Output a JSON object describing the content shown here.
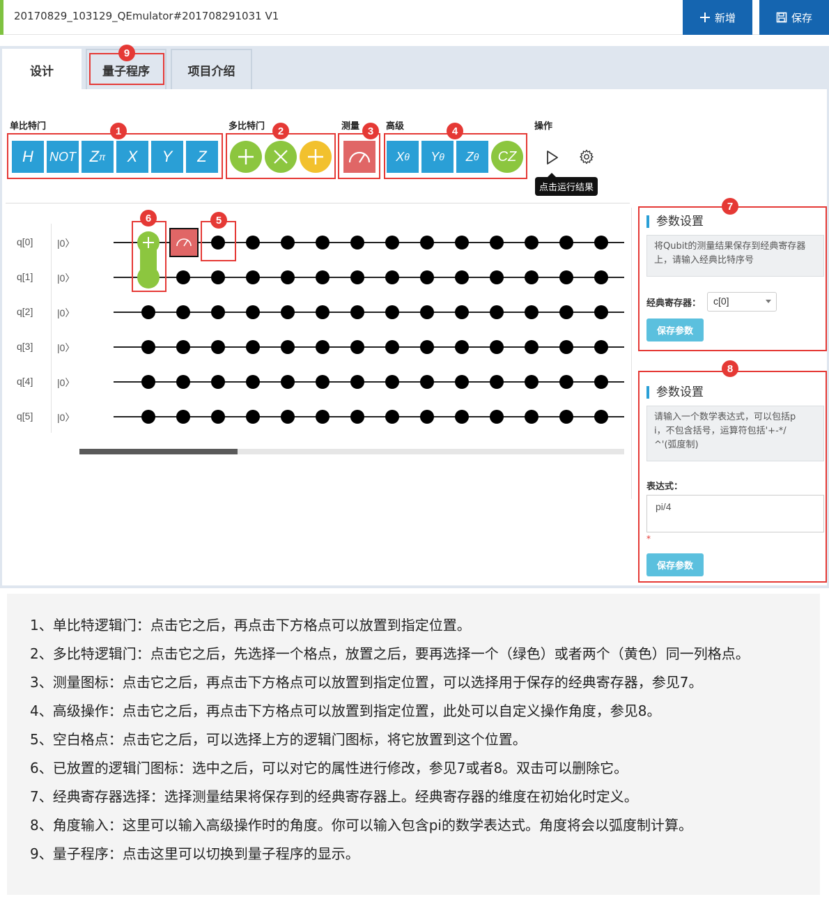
{
  "header": {
    "title": "20170829_103129_QEmulator#201708291031 V1",
    "add_label": "新增",
    "save_label": "保存"
  },
  "tabs": [
    {
      "label": "设计"
    },
    {
      "label": "量子程序"
    },
    {
      "label": "项目介绍"
    }
  ],
  "toolbar": {
    "groups": [
      "单比特门",
      "多比特门",
      "测量",
      "高级",
      "操作"
    ],
    "single_gates": [
      "H",
      "NOT",
      "X",
      "Y",
      "Z"
    ],
    "zpi": {
      "base": "Z",
      "sub": "π"
    },
    "advanced_gates": [
      {
        "base": "X",
        "sub": "θ"
      },
      {
        "base": "Y",
        "sub": "θ"
      },
      {
        "base": "Z",
        "sub": "θ"
      }
    ],
    "cz_label": "CZ",
    "run_tooltip": "点击运行结果",
    "icons": [
      "plus-icon",
      "cross-icon",
      "measure-icon",
      "play-icon",
      "gear-icon"
    ]
  },
  "circuit": {
    "qubits": [
      "q[0]",
      "q[1]",
      "q[2]",
      "q[3]",
      "q[4]",
      "q[5]"
    ],
    "init_states": [
      "|0〉",
      "|0〉",
      "|0〉",
      "|0〉",
      "|0〉",
      "|0〉"
    ],
    "scrollbar_fraction": 0.29
  },
  "param_panel_1": {
    "title": "参数设置",
    "desc_line1": "将Qubit的测量结果保存到经典寄存器",
    "desc_line2": "上，请输入经典比特序号",
    "register_label": "经典寄存器：",
    "register_value": "c[0]",
    "save_label": "保存参数"
  },
  "param_panel_2": {
    "title": "参数设置",
    "desc_line1": "请输入一个数学表达式，可以包括p",
    "desc_line2": "i，不包含括号，运算符包括'+-*/",
    "desc_line3": "^'(弧度制)",
    "expr_label": "表达式：",
    "expr_value": "pi/4",
    "required_mark": "*",
    "save_label": "保存参数"
  },
  "badges": [
    "1",
    "2",
    "3",
    "4",
    "5",
    "6",
    "7",
    "8",
    "9"
  ],
  "notes": [
    "1、单比特逻辑门：点击它之后，再点击下方格点可以放置到指定位置。",
    "2、多比特逻辑门：点击它之后，先选择一个格点，放置之后，要再选择一个（绿色）或者两个（黄色）同一列格点。",
    "3、测量图标：点击它之后，再点击下方格点可以放置到指定位置，可以选择用于保存的经典寄存器，参见7。",
    "4、高级操作：点击它之后，再点击下方格点可以放置到指定位置，此处可以自定义操作角度，参见8。",
    "5、空白格点：点击它之后，可以选择上方的逻辑门图标，将它放置到这个位置。",
    "6、已放置的逻辑门图标：选中之后，可以对它的属性进行修改，参见7或者8。双击可以删除它。",
    "7、经典寄存器选择：选择测量结果将保存到的经典寄存器上。经典寄存器的维度在初始化时定义。",
    "8、角度输入：这里可以输入高级操作时的角度。你可以输入包含pi的数学表达式。角度将会以弧度制计算。",
    "9、量子程序：点击这里可以切换到量子程序的显示。"
  ],
  "colors": {
    "primary": "#1565b0",
    "gate_blue": "#2a9fd6",
    "gate_green": "#8cc63f",
    "gate_yellow": "#f2c12e",
    "measure_red": "#e06666",
    "callout_red": "#e53935"
  }
}
